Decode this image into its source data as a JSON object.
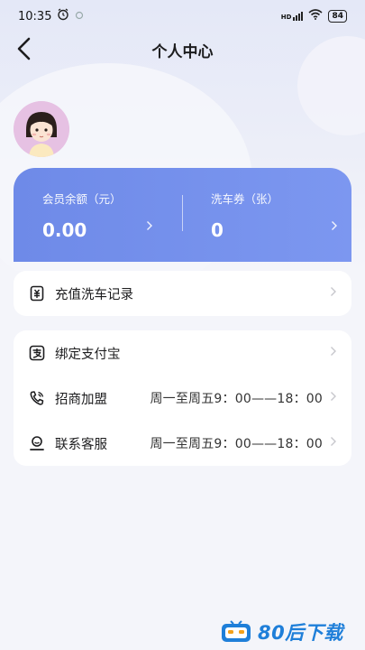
{
  "status_bar": {
    "time": "10:35",
    "network": "HD",
    "battery": "84"
  },
  "nav": {
    "title": "个人中心"
  },
  "balance": {
    "member_label": "会员余额（元）",
    "member_value": "0.00",
    "coupon_label": "洗车券（张）",
    "coupon_value": "0"
  },
  "menu_top": [
    {
      "label": "充值洗车记录",
      "icon": "receipt-icon"
    }
  ],
  "menu_bottom": [
    {
      "label": "绑定支付宝",
      "icon": "alipay-icon",
      "value": ""
    },
    {
      "label": "招商加盟",
      "icon": "phone-icon",
      "value": "周一至周五9：00——18：00"
    },
    {
      "label": "联系客服",
      "icon": "customer-service-icon",
      "value": "周一至周五9：00——18：00"
    }
  ],
  "watermark": {
    "text": "80后下载"
  },
  "colors": {
    "card_blue": "#7390ec",
    "background": "#f4f5fa",
    "watermark": "#1f7fd9"
  }
}
